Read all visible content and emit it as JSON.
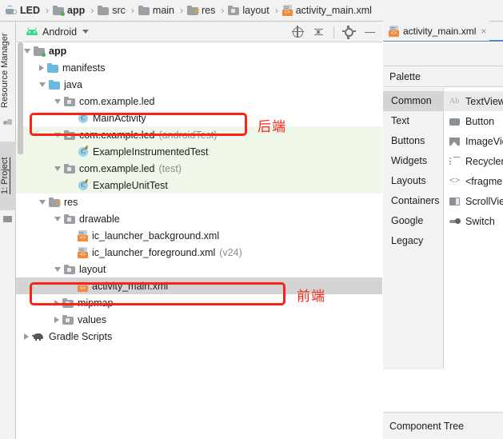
{
  "breadcrumb": [
    {
      "label": "LED",
      "icon": "cup-icon",
      "bold": true
    },
    {
      "label": "app",
      "icon": "module-folder-icon",
      "bold": true
    },
    {
      "label": "src",
      "icon": "folder-icon",
      "bold": false
    },
    {
      "label": "main",
      "icon": "folder-icon",
      "bold": false
    },
    {
      "label": "res",
      "icon": "res-folder-icon",
      "bold": false
    },
    {
      "label": "layout",
      "icon": "package-folder-icon",
      "bold": false
    },
    {
      "label": "activity_main.xml",
      "icon": "xml-file-icon",
      "bold": false
    }
  ],
  "separator": "›",
  "tool_window_tabs": [
    {
      "label": "Resource Manager",
      "active": false
    },
    {
      "label": "1: Project",
      "active": true
    }
  ],
  "project_panel": {
    "title": "Android",
    "toolbar_icons": [
      "select-opened-file-icon",
      "collapse-all-icon",
      "settings-gear-icon",
      "hide-icon"
    ],
    "tree": [
      {
        "label": "app",
        "depth": 0,
        "arrow": "open",
        "icon": "module-folder-icon",
        "bold": true,
        "sub": "",
        "state": "normal"
      },
      {
        "label": "manifests",
        "depth": 1,
        "arrow": "closed",
        "icon": "blue-folder-icon",
        "bold": false,
        "sub": "",
        "state": "normal"
      },
      {
        "label": "java",
        "depth": 1,
        "arrow": "open",
        "icon": "blue-folder-icon",
        "bold": false,
        "sub": "",
        "state": "normal"
      },
      {
        "label": "com.example.led",
        "depth": 2,
        "arrow": "open",
        "icon": "package-folder-icon",
        "bold": false,
        "sub": "",
        "state": "normal"
      },
      {
        "label": "MainActivity",
        "depth": 3,
        "arrow": "none",
        "icon": "java-class-icon",
        "bold": false,
        "sub": "",
        "state": "normal"
      },
      {
        "label": "com.example.led",
        "depth": 2,
        "arrow": "open",
        "icon": "package-folder-icon",
        "bold": false,
        "sub": "(androidTest)",
        "state": "green"
      },
      {
        "label": "ExampleInstrumentedTest",
        "depth": 3,
        "arrow": "none",
        "icon": "java-test-class-icon",
        "bold": false,
        "sub": "",
        "state": "green"
      },
      {
        "label": "com.example.led",
        "depth": 2,
        "arrow": "open",
        "icon": "package-folder-icon",
        "bold": false,
        "sub": "(test)",
        "state": "green"
      },
      {
        "label": "ExampleUnitTest",
        "depth": 3,
        "arrow": "none",
        "icon": "java-test-class-icon",
        "bold": false,
        "sub": "",
        "state": "green"
      },
      {
        "label": "res",
        "depth": 1,
        "arrow": "open",
        "icon": "res-folder-icon",
        "bold": false,
        "sub": "",
        "state": "normal"
      },
      {
        "label": "drawable",
        "depth": 2,
        "arrow": "open",
        "icon": "package-folder-icon",
        "bold": false,
        "sub": "",
        "state": "normal"
      },
      {
        "label": "ic_launcher_background.xml",
        "depth": 3,
        "arrow": "none",
        "icon": "xml-file-icon",
        "bold": false,
        "sub": "",
        "state": "normal"
      },
      {
        "label": "ic_launcher_foreground.xml",
        "depth": 3,
        "arrow": "none",
        "icon": "xml-file-icon",
        "bold": false,
        "sub": "(v24)",
        "state": "normal"
      },
      {
        "label": "layout",
        "depth": 2,
        "arrow": "open",
        "icon": "package-folder-icon",
        "bold": false,
        "sub": "",
        "state": "normal"
      },
      {
        "label": "activity_main.xml",
        "depth": 3,
        "arrow": "none",
        "icon": "xml-file-icon",
        "bold": false,
        "sub": "",
        "state": "selected"
      },
      {
        "label": "mipmap",
        "depth": 2,
        "arrow": "closed",
        "icon": "package-folder-icon",
        "bold": false,
        "sub": "",
        "state": "normal"
      },
      {
        "label": "values",
        "depth": 2,
        "arrow": "closed",
        "icon": "package-folder-icon",
        "bold": false,
        "sub": "",
        "state": "normal"
      },
      {
        "label": "Gradle Scripts",
        "depth": 0,
        "arrow": "closed",
        "icon": "gradle-icon",
        "bold": false,
        "sub": "",
        "state": "normal"
      }
    ]
  },
  "annotations": [
    {
      "text": "后端",
      "name": "backend-annotation"
    },
    {
      "text": "前端",
      "name": "frontend-annotation"
    }
  ],
  "annotation_color": "#fb2316",
  "editor": {
    "tab": {
      "label": "activity_main.xml",
      "close": "×",
      "icon": "xml-file-icon"
    },
    "palette_title": "Palette",
    "categories": [
      {
        "label": "Common",
        "active": true
      },
      {
        "label": "Text",
        "active": false
      },
      {
        "label": "Buttons",
        "active": false
      },
      {
        "label": "Widgets",
        "active": false
      },
      {
        "label": "Layouts",
        "active": false
      },
      {
        "label": "Containers",
        "active": false
      },
      {
        "label": "Google",
        "active": false
      },
      {
        "label": "Legacy",
        "active": false
      }
    ],
    "items": [
      {
        "label": "TextView",
        "icon": "textview-icon",
        "active": true
      },
      {
        "label": "Button",
        "icon": "button-icon",
        "active": false
      },
      {
        "label": "ImageView",
        "icon": "imageview-icon",
        "active": false
      },
      {
        "label": "RecyclerView",
        "icon": "recyclerview-icon",
        "active": false
      },
      {
        "label": "<fragment>",
        "icon": "fragment-icon",
        "active": false
      },
      {
        "label": "ScrollView",
        "icon": "scrollview-icon",
        "active": false
      },
      {
        "label": "Switch",
        "icon": "switch-icon",
        "active": false
      }
    ],
    "component_tree_title": "Component Tree"
  }
}
